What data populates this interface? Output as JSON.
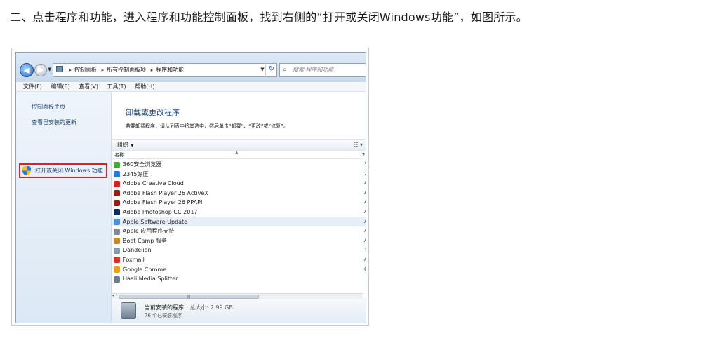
{
  "caption": "二、点击程序和功能，进入程序和功能控制面板，找到右侧的“打开或关闭Windows功能”，如图所示。",
  "address": {
    "crumbs": [
      "控制面板",
      "所有控制面板项",
      "程序和功能"
    ],
    "search_placeholder": "搜索 程序和功能"
  },
  "menu": [
    "文件(F)",
    "编辑(E)",
    "查看(V)",
    "工具(T)",
    "帮助(H)"
  ],
  "left_pane": {
    "home": "控制面板主页",
    "updates": "查看已安装的更新",
    "features": "打开或关闭 Windows 功能"
  },
  "right_pane": {
    "title": "卸载或更改程序",
    "description": "若要卸载程序，请从列表中将其选中，然后单击“卸载”、“更改”或“修复”。",
    "organize": "组织",
    "column_name": "名称",
    "column_second": "2"
  },
  "programs": [
    {
      "name": "360安全浏览器",
      "tail": "3",
      "color": "#3fae2a"
    },
    {
      "name": "2345好压",
      "tail": "2",
      "color": "#2b7bd6"
    },
    {
      "name": "Adobe Creative Cloud",
      "tail": "A",
      "color": "#da1f26"
    },
    {
      "name": "Adobe Flash Player 26 ActiveX",
      "tail": "A",
      "color": "#9c1b1b"
    },
    {
      "name": "Adobe Flash Player 26 PPAPI",
      "tail": "A",
      "color": "#9c1b1b"
    },
    {
      "name": "Adobe Photoshop CC 2017",
      "tail": "A",
      "color": "#0b2d57"
    },
    {
      "name": "Apple Software Update",
      "tail": "A",
      "color": "#4a8fd6"
    },
    {
      "name": "Apple 应用程序支持",
      "tail": "A",
      "color": "#7d8a99"
    },
    {
      "name": "Boot Camp 服务",
      "tail": "A",
      "color": "#c88a2a"
    },
    {
      "name": "Dandelion",
      "tail": "T",
      "color": "#8899aa"
    },
    {
      "name": "Foxmail",
      "tail": "A",
      "color": "#d9342b"
    },
    {
      "name": "Google Chrome",
      "tail": "C",
      "color": "#e8a317"
    },
    {
      "name": "Haali Media Splitter",
      "tail": "",
      "color": "#6f7c8a"
    }
  ],
  "status": {
    "installed_label": "当前安装的程序",
    "total_size": "总大小: 2.99 GB",
    "count": "76 个已安装程序"
  }
}
